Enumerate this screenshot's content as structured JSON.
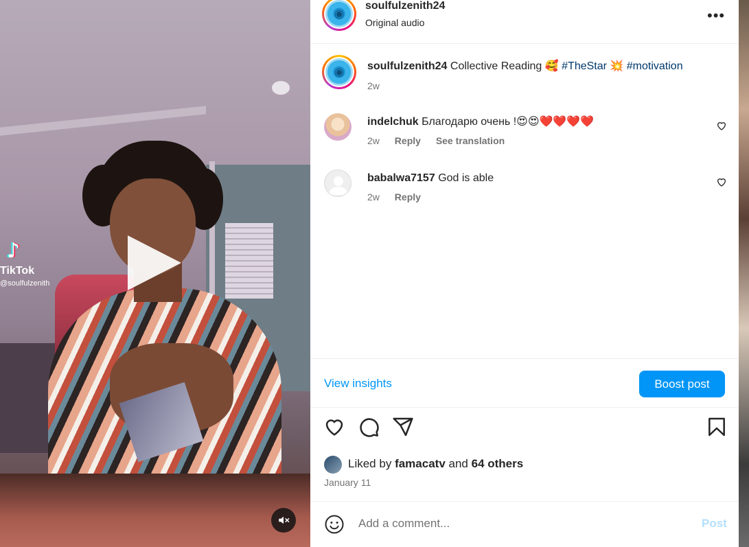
{
  "video": {
    "watermark_brand": "TikTok",
    "watermark_handle": "@soulfulzenith"
  },
  "header": {
    "username": "soulfulzenith24",
    "subtitle": "Original audio"
  },
  "caption": {
    "username": "soulfulzenith24",
    "text": "Collective Reading",
    "emoji1": "🥰",
    "tag1": "#TheStar",
    "emoji2": "💥",
    "tag2": "#motivation",
    "time": "2w"
  },
  "comments": [
    {
      "username": "indelchuk",
      "text": "Благодарю очень !😍😍❤️❤️❤️❤️",
      "time": "2w",
      "reply": "Reply",
      "translate": "See translation"
    },
    {
      "username": "babalwa7157",
      "text": "God is able",
      "time": "2w",
      "reply": "Reply"
    }
  ],
  "insights": {
    "view_label": "View insights",
    "boost_label": "Boost post"
  },
  "likes": {
    "prefix": "Liked by",
    "user": "famacatv",
    "and": "and",
    "others": "64 others"
  },
  "date": "January 11",
  "composer": {
    "placeholder": "Add a comment...",
    "post_label": "Post"
  },
  "colors": {
    "accent": "#0095f6",
    "hashtag": "#00376b",
    "muted": "#737373",
    "post_disabled": "#b2dffc"
  }
}
